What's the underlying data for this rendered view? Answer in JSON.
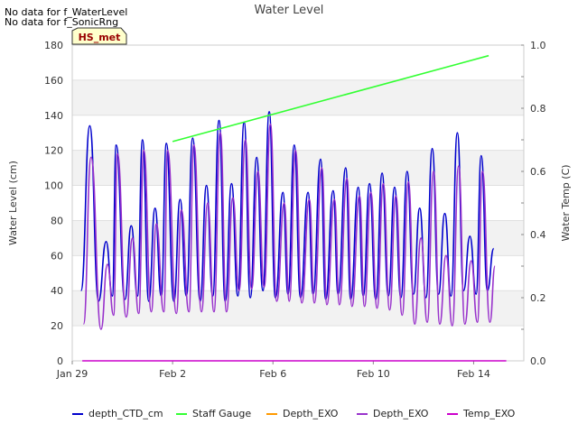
{
  "notes": [
    "No data for f_WaterLevel",
    "No data for f_SonicRng"
  ],
  "badge": "HS_met",
  "chart_data": {
    "type": "line",
    "title": "Water Level",
    "ylabel": "Water Level (cm)",
    "y2label": "Water Temp (C)",
    "ylim": [
      0,
      180
    ],
    "y2lim": [
      0.0,
      1.0
    ],
    "yticks": [
      0,
      20,
      40,
      60,
      80,
      100,
      120,
      140,
      160,
      180
    ],
    "y2ticks": [
      "0.0",
      "0.2",
      "0.4",
      "0.6",
      "0.8",
      "1.0"
    ],
    "xlim": [
      "Jan 29",
      "Feb 16"
    ],
    "xticks": [
      {
        "label": "Jan 29",
        "day": 0
      },
      {
        "label": "Feb 2",
        "day": 4
      },
      {
        "label": "Feb 6",
        "day": 8
      },
      {
        "label": "Feb 10",
        "day": 12
      },
      {
        "label": "Feb 14",
        "day": 16
      }
    ],
    "grid": "horizontal bands",
    "series": [
      {
        "name": "depth_CTD_cm",
        "color": "#0000cc",
        "peaks": [
          [
            0.7,
            134
          ],
          [
            1.35,
            68
          ],
          [
            1.75,
            123
          ],
          [
            2.35,
            77
          ],
          [
            2.8,
            126
          ],
          [
            3.3,
            87
          ],
          [
            3.75,
            124
          ],
          [
            4.3,
            92
          ],
          [
            4.8,
            127
          ],
          [
            5.35,
            100
          ],
          [
            5.85,
            137
          ],
          [
            6.35,
            101
          ],
          [
            6.85,
            136
          ],
          [
            7.35,
            116
          ],
          [
            7.85,
            142
          ],
          [
            8.4,
            96
          ],
          [
            8.85,
            123
          ],
          [
            9.4,
            96
          ],
          [
            9.9,
            115
          ],
          [
            10.4,
            97
          ],
          [
            10.9,
            110
          ],
          [
            11.4,
            99
          ],
          [
            11.85,
            101
          ],
          [
            12.35,
            107
          ],
          [
            12.85,
            99
          ],
          [
            13.35,
            108
          ],
          [
            13.85,
            87
          ],
          [
            14.35,
            121
          ],
          [
            14.85,
            84
          ],
          [
            15.35,
            130
          ],
          [
            15.85,
            71
          ],
          [
            16.3,
            117
          ],
          [
            16.8,
            64
          ]
        ],
        "troughs": [
          [
            0.35,
            40
          ],
          [
            1.05,
            34
          ],
          [
            1.6,
            37
          ],
          [
            2.1,
            35
          ],
          [
            2.6,
            37
          ],
          [
            3.05,
            34
          ],
          [
            3.55,
            37
          ],
          [
            4.05,
            34
          ],
          [
            4.55,
            37
          ],
          [
            5.1,
            34
          ],
          [
            5.6,
            37
          ],
          [
            6.1,
            34
          ],
          [
            6.6,
            37
          ],
          [
            7.1,
            36
          ],
          [
            7.6,
            40
          ],
          [
            8.1,
            36
          ],
          [
            8.6,
            38
          ],
          [
            9.1,
            36
          ],
          [
            9.6,
            38
          ],
          [
            10.1,
            35
          ],
          [
            10.6,
            38
          ],
          [
            11.1,
            35
          ],
          [
            11.6,
            37
          ],
          [
            12.1,
            35
          ],
          [
            12.6,
            37
          ],
          [
            13.1,
            36
          ],
          [
            13.6,
            38
          ],
          [
            14.1,
            36
          ],
          [
            14.6,
            38
          ],
          [
            15.1,
            37
          ],
          [
            15.6,
            40
          ],
          [
            16.1,
            38
          ],
          [
            16.55,
            40
          ]
        ]
      },
      {
        "name": "Staff Gauge",
        "color": "#33ff33",
        "points": [
          [
            4.0,
            125
          ],
          [
            16.6,
            174
          ]
        ]
      },
      {
        "name": "Depth_EXO",
        "color": "#ff9900",
        "points": []
      },
      {
        "name": "Depth_EXO",
        "color": "#9933cc",
        "peaks": [
          [
            0.75,
            116
          ],
          [
            1.4,
            55
          ],
          [
            1.8,
            118
          ],
          [
            2.4,
            70
          ],
          [
            2.85,
            120
          ],
          [
            3.35,
            78
          ],
          [
            3.8,
            120
          ],
          [
            4.35,
            86
          ],
          [
            4.85,
            123
          ],
          [
            5.4,
            90
          ],
          [
            5.9,
            130
          ],
          [
            6.4,
            93
          ],
          [
            6.9,
            126
          ],
          [
            7.4,
            108
          ],
          [
            7.9,
            135
          ],
          [
            8.45,
            90
          ],
          [
            8.9,
            120
          ],
          [
            9.45,
            92
          ],
          [
            9.95,
            110
          ],
          [
            10.45,
            92
          ],
          [
            10.95,
            104
          ],
          [
            11.45,
            94
          ],
          [
            11.9,
            96
          ],
          [
            12.4,
            101
          ],
          [
            12.9,
            94
          ],
          [
            13.4,
            102
          ],
          [
            13.9,
            70
          ],
          [
            14.4,
            108
          ],
          [
            14.9,
            60
          ],
          [
            15.4,
            111
          ],
          [
            15.9,
            57
          ],
          [
            16.35,
            108
          ],
          [
            16.85,
            54
          ]
        ],
        "troughs": [
          [
            0.45,
            21
          ],
          [
            1.15,
            18
          ],
          [
            1.65,
            26
          ],
          [
            2.15,
            25
          ],
          [
            2.65,
            27
          ],
          [
            3.15,
            28
          ],
          [
            3.65,
            28
          ],
          [
            4.15,
            27
          ],
          [
            4.65,
            28
          ],
          [
            5.15,
            28
          ],
          [
            5.65,
            28
          ],
          [
            6.15,
            28
          ],
          [
            6.65,
            40
          ],
          [
            7.15,
            41
          ],
          [
            7.65,
            42
          ],
          [
            8.15,
            34
          ],
          [
            8.65,
            34
          ],
          [
            9.15,
            33
          ],
          [
            9.65,
            33
          ],
          [
            10.15,
            32
          ],
          [
            10.65,
            32
          ],
          [
            11.15,
            31
          ],
          [
            11.65,
            31
          ],
          [
            12.15,
            30
          ],
          [
            12.65,
            29
          ],
          [
            13.15,
            26
          ],
          [
            13.65,
            21
          ],
          [
            14.15,
            22
          ],
          [
            14.65,
            21
          ],
          [
            15.15,
            20
          ],
          [
            15.65,
            21
          ],
          [
            16.15,
            22
          ],
          [
            16.65,
            22
          ]
        ]
      },
      {
        "name": "Temp_EXO",
        "color": "#cc00cc",
        "points": [
          [
            0.4,
            0.0
          ],
          [
            17.3,
            0.0
          ]
        ]
      }
    ]
  }
}
